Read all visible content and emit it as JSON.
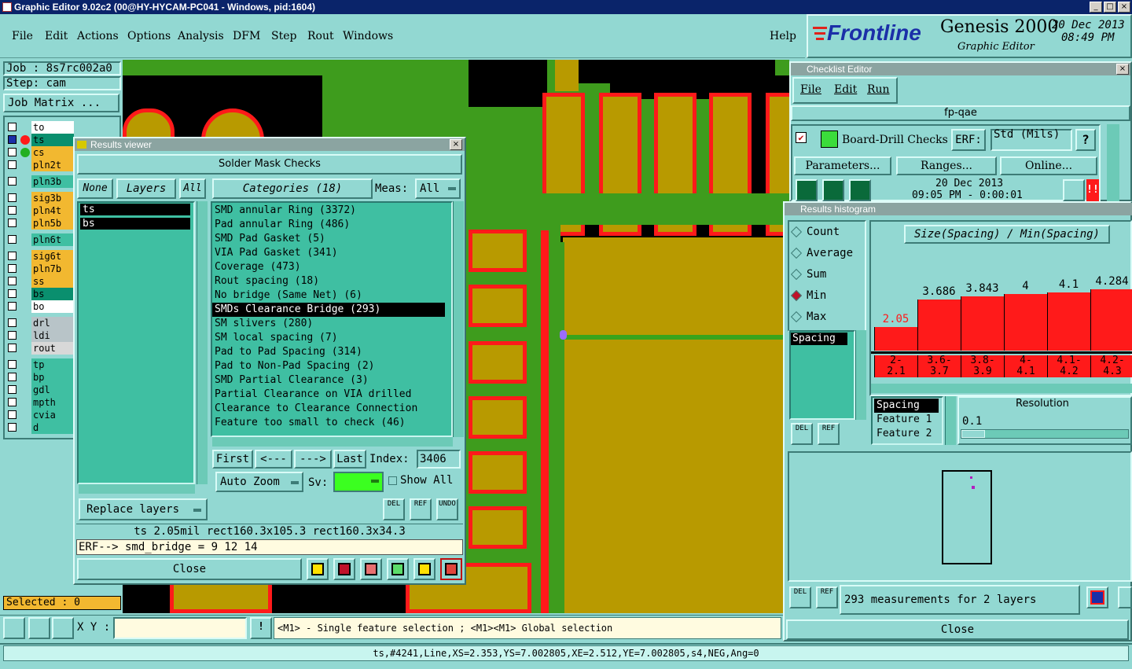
{
  "window": {
    "title": "Graphic Editor 9.02c2 (00@HY-HYCAM-PC041 - Windows, pid:1604)"
  },
  "menu": [
    "File",
    "Edit",
    "Actions",
    "Options",
    "Analysis",
    "DFM",
    "Step",
    "Rout",
    "Windows"
  ],
  "help": "Help",
  "brand": {
    "logo": "Frontline",
    "product": "Genesis 2000",
    "subtitle": "Graphic Editor",
    "date": "20 Dec 2013",
    "time": "08:49 PM"
  },
  "job": {
    "job": "Job : 8s7rc002a0",
    "step": "Step: cam",
    "matrix_btn": "Job Matrix ..."
  },
  "layers": [
    {
      "name": "to",
      "color": "#ffffff",
      "dot": "",
      "sel": false
    },
    {
      "name": "ts",
      "color": "#0a8f6e",
      "dot": "#ff1a1a",
      "sel": true
    },
    {
      "name": "cs",
      "color": "#f2b830",
      "dot": "#22b022",
      "sel": false
    },
    {
      "name": "pln2t",
      "color": "#f2b830",
      "dot": "",
      "sel": false
    },
    {
      "name": "pln3b",
      "color": "#3fbfa2",
      "dot": "",
      "sel": false
    },
    {
      "name": "sig3b",
      "color": "#f2b830",
      "dot": "",
      "sel": false
    },
    {
      "name": "pln4t",
      "color": "#f2b830",
      "dot": "",
      "sel": false
    },
    {
      "name": "pln5b",
      "color": "#f2b830",
      "dot": "",
      "sel": false
    },
    {
      "name": "pln6t",
      "color": "#3fbfa2",
      "dot": "",
      "sel": false
    },
    {
      "name": "sig6t",
      "color": "#f2b830",
      "dot": "",
      "sel": false
    },
    {
      "name": "pln7b",
      "color": "#f2b830",
      "dot": "",
      "sel": false
    },
    {
      "name": "ss",
      "color": "#f2b830",
      "dot": "",
      "sel": false
    },
    {
      "name": "bs",
      "color": "#0a8f6e",
      "dot": "",
      "sel": false
    },
    {
      "name": "bo",
      "color": "#ffffff",
      "dot": "",
      "sel": false
    },
    {
      "name": "drl",
      "color": "#b8c4c8",
      "dot": "",
      "sel": false
    },
    {
      "name": "ldi",
      "color": "#b8c4c8",
      "dot": "",
      "sel": false
    },
    {
      "name": "rout",
      "color": "#d8d8d8",
      "dot": "",
      "sel": false
    },
    {
      "name": "tp",
      "color": "#3fbfa2",
      "dot": "",
      "sel": false
    },
    {
      "name": "bp",
      "color": "#3fbfa2",
      "dot": "",
      "sel": false
    },
    {
      "name": "gdl",
      "color": "#3fbfa2",
      "dot": "",
      "sel": false
    },
    {
      "name": "mpth",
      "color": "#3fbfa2",
      "dot": "",
      "sel": false
    },
    {
      "name": "cvia",
      "color": "#3fbfa2",
      "dot": "",
      "sel": false
    },
    {
      "name": "d",
      "color": "#3fbfa2",
      "dot": "",
      "sel": false
    }
  ],
  "selected": "Selected : 0",
  "results_viewer": {
    "title": "Results viewer",
    "header": "Solder Mask Checks",
    "none": "None",
    "layers": "Layers",
    "all": "All",
    "categories_btn": "Categories (18)",
    "meas_label": "Meas:",
    "meas_value": "All",
    "layer_list": [
      "ts",
      "bs"
    ],
    "categories": [
      "SMD annular Ring (3372)",
      "Pad annular Ring (486)",
      "SMD Pad Gasket (5)",
      "VIA Pad Gasket (341)",
      "Coverage (473)",
      "Rout spacing (18)",
      "No bridge (Same Net) (6)",
      "SMDs Clearance Bridge (293)",
      "SM slivers (280)",
      "SM local spacing (7)",
      "Pad to Pad Spacing (314)",
      "Pad to Non-Pad Spacing (2)",
      "SMD Partial Clearance (3)",
      "Partial Clearance on VIA drilled",
      "Clearance to Clearance Connection",
      "Feature too small to check (46)"
    ],
    "selected_category": 7,
    "first": "First",
    "prev": "<---",
    "next": "--->",
    "last": "Last",
    "index_label": "Index:",
    "index_value": "3406",
    "auto_zoom": "Auto Zoom",
    "sv_label": "Sv:",
    "show_all": "Show All",
    "replace_layers": "Replace layers",
    "del": "DEL",
    "ref": "REF",
    "undo": "UNDO",
    "info": "ts 2.05mil  rect160.3x105.3  rect160.3x34.3",
    "erf": "ERF--> smd_bridge = 9 12 14",
    "close": "Close"
  },
  "checklist": {
    "title": "Checklist Editor",
    "menu": [
      "File",
      "Edit",
      "Run"
    ],
    "name": "fp-qae",
    "action": "Board-Drill Checks",
    "erf_label": "ERF:",
    "erf_value": "Std (Mils)",
    "parameters": "Parameters...",
    "ranges": "Ranges...",
    "online": "Online...",
    "run_date": "20 Dec 2013",
    "run_time": "09:05 PM - 0:00:01"
  },
  "histogram": {
    "title": "Results histogram",
    "modes": [
      "Count",
      "Average",
      "Sum",
      "Min",
      "Max"
    ],
    "selected_mode": "Min",
    "formula": "Size(Spacing) / Min(Spacing)",
    "list": [
      "Spacing"
    ],
    "list2": [
      "Spacing",
      "Feature 1",
      "Feature 2"
    ],
    "resolution_label": "Resolution",
    "resolution_value": "0.1",
    "measurements": "293 measurements for 2 layers",
    "close": "Close",
    "del": "DEL",
    "ref": "REF"
  },
  "chart_data": {
    "type": "bar",
    "categories": [
      "2-2.1",
      "3.6-3.7",
      "3.8-3.9",
      "4-4.1",
      "4.1-4.2",
      "4.2-4.3"
    ],
    "values": [
      2.05,
      3.686,
      3.843,
      4,
      4.1,
      4.284
    ],
    "value_labels": [
      "2.05",
      "3.686",
      "3.843",
      "4",
      "4.1",
      "4.284"
    ],
    "bin_top": [
      "2-",
      "3.6-",
      "3.8-",
      "4-",
      "4.1-",
      "4.2-"
    ],
    "bin_bottom": [
      "2.1",
      "3.7",
      "3.9",
      "4.1",
      "4.2",
      "4.3"
    ],
    "title": "Size(Spacing) / Min(Spacing)",
    "color": "#ff1a1a"
  },
  "bottom": {
    "xy_label": "X Y :",
    "xy_value": "",
    "hint": "<M1> - Single feature selection ; <M1><M1> Global selection",
    "status": "ts,#4241,Line,XS=2.353,YS=7.002805,XE=2.512,YE=7.002805,s4,NEG,Ang=0"
  }
}
